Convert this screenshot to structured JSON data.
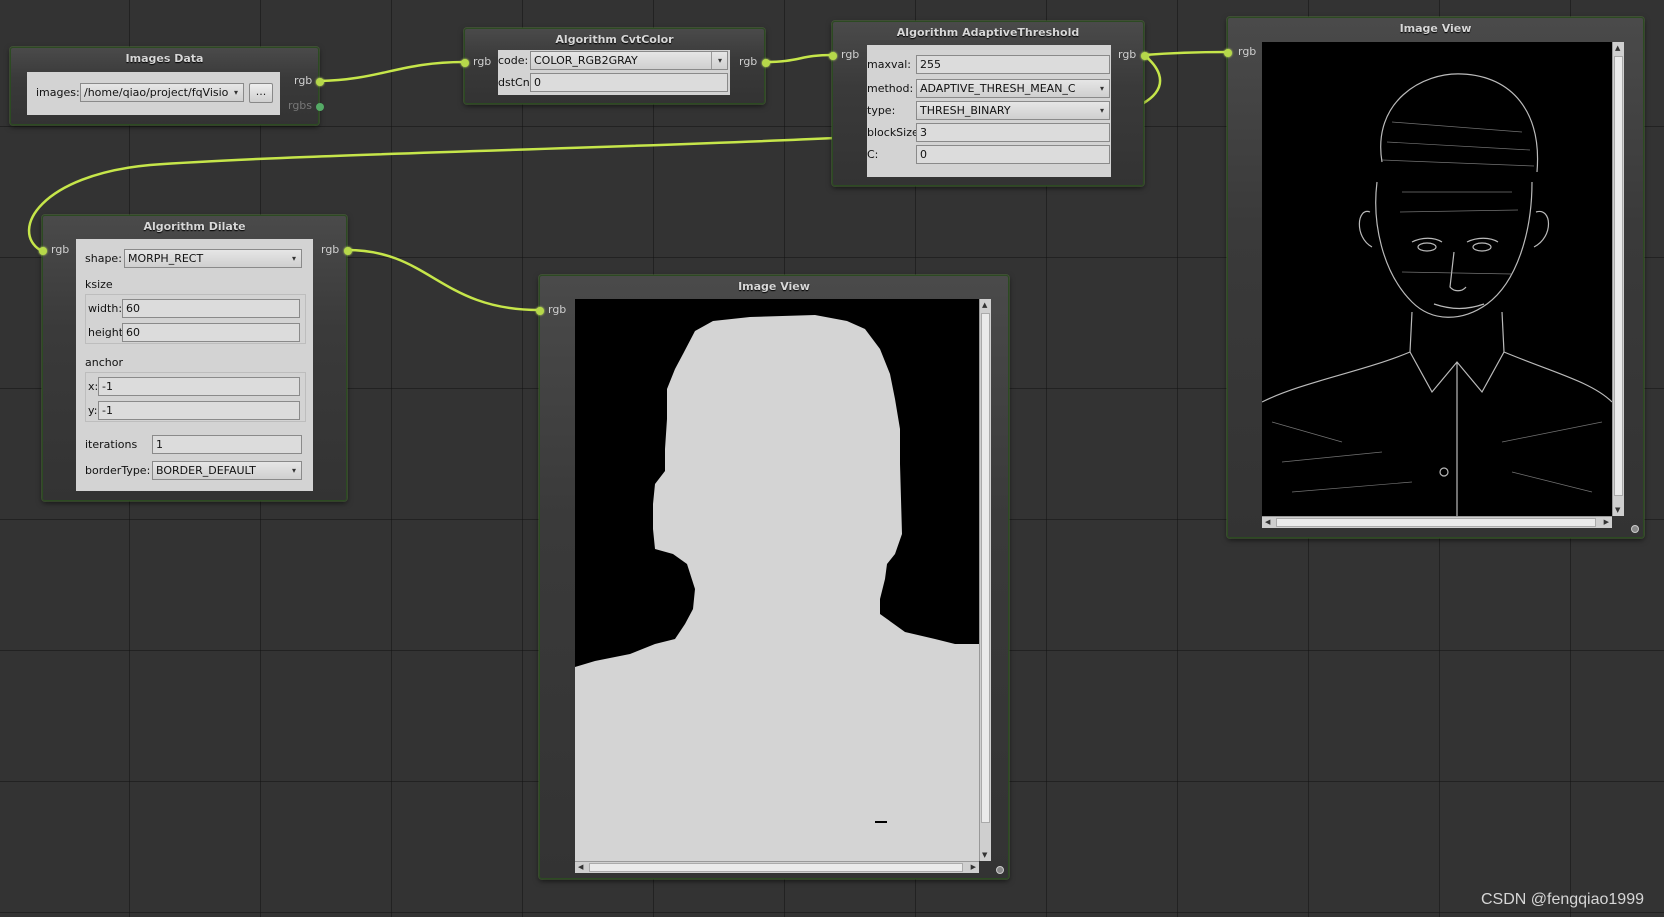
{
  "nodes": {
    "images_data": {
      "title": "Images Data",
      "images_label": "images:",
      "images_value": "/home/qiao/project/fqVisio",
      "browse_label": "...",
      "out_rgb": "rgb",
      "out_rgbs": "rgbs"
    },
    "cvtcolor": {
      "title": "Algorithm CvtColor",
      "in_rgb": "rgb",
      "out_rgb": "rgb",
      "code_label": "code:",
      "code_value": "COLOR_RGB2GRAY",
      "dstcn_label": "dstCn:",
      "dstcn_value": "0"
    },
    "adaptive": {
      "title": "Algorithm AdaptiveThreshold",
      "in_rgb": "rgb",
      "out_rgb": "rgb",
      "maxval_label": "maxval:",
      "maxval_value": "255",
      "method_label": "method:",
      "method_value": "ADAPTIVE_THRESH_MEAN_C",
      "type_label": "type:",
      "type_value": "THRESH_BINARY",
      "blocksize_label": "blockSize:",
      "blocksize_value": "3",
      "c_label": "C:",
      "c_value": "0"
    },
    "imageview_top": {
      "title": "Image View",
      "in_rgb": "rgb"
    },
    "dilate": {
      "title": "Algorithm Dilate",
      "in_rgb": "rgb",
      "out_rgb": "rgb",
      "shape_label": "shape:",
      "shape_value": "MORPH_RECT",
      "ksize_label": "ksize",
      "width_label": "width:",
      "width_value": "60",
      "height_label": "height:",
      "height_value": "60",
      "anchor_label": "anchor",
      "x_label": "x:",
      "x_value": "-1",
      "y_label": "y:",
      "y_value": "-1",
      "iterations_label": "iterations",
      "iterations_value": "1",
      "bordertype_label": "borderType:",
      "bordertype_value": "BORDER_DEFAULT"
    },
    "imageview_mid": {
      "title": "Image View",
      "in_rgb": "rgb"
    }
  },
  "watermark": "CSDN @fengqiao1999",
  "colors": {
    "wire": "#c6e64a",
    "port": "#b6d84a",
    "canvas": "#333333",
    "silhouette": "#d4d4d4"
  },
  "icons": {
    "dropdown": "▾",
    "scroll_up": "▲",
    "scroll_down": "▼",
    "scroll_left": "◀",
    "scroll_right": "▶"
  }
}
